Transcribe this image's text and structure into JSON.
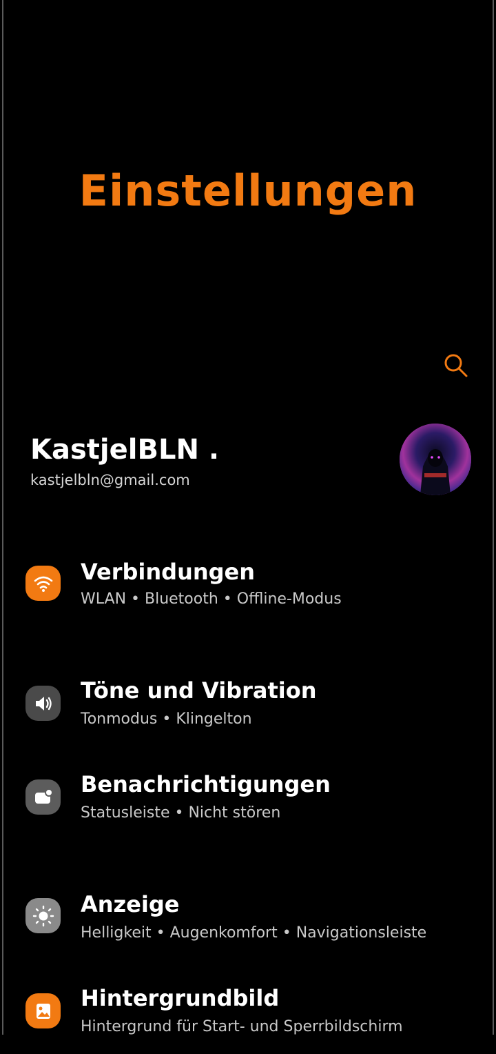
{
  "page": {
    "title": "Einstellungen",
    "accent": "#f27a12"
  },
  "search": {
    "icon": "search-icon"
  },
  "profile": {
    "name": "KastjelBLN .",
    "email": "kastjelbln@gmail.com"
  },
  "settings": [
    {
      "label": "Verbindungen",
      "sub": "WLAN  •  Bluetooth  •  Offline-Modus",
      "icon": "wifi-icon",
      "color": "#f27a12"
    },
    {
      "label": "Töne und Vibration",
      "sub": "Tonmodus  •  Klingelton",
      "icon": "speaker-icon",
      "color": "#4a4a4a"
    },
    {
      "label": "Benachrichtigungen",
      "sub": "Statusleiste  •  Nicht stören",
      "icon": "notification-icon",
      "color": "#5c5c5c"
    },
    {
      "label": "Anzeige",
      "sub": "Helligkeit  •  Augenkomfort  •  Navigationsleiste",
      "icon": "brightness-icon",
      "color": "#8a8a8a"
    },
    {
      "label": "Hintergrundbild",
      "sub": "Hintergrund für Start- und Sperrbildschirm",
      "icon": "wallpaper-icon",
      "color": "#f27a12"
    }
  ]
}
